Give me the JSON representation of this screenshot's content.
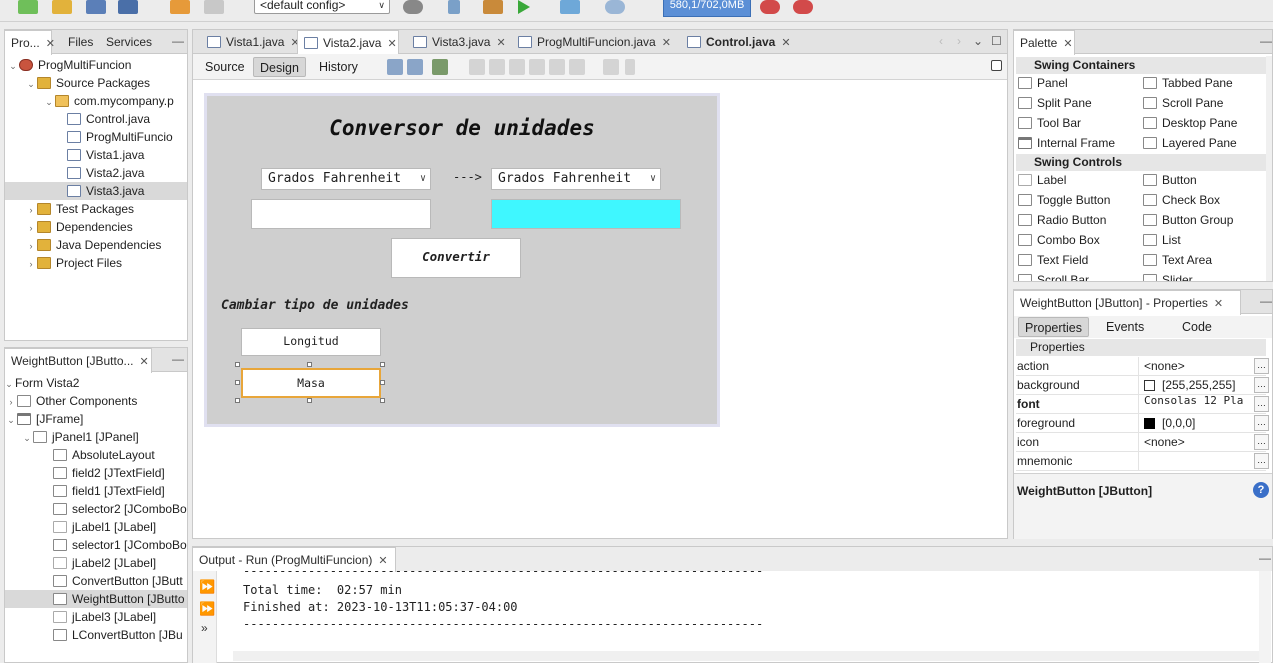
{
  "toolbar": {
    "config_value": "<default config>",
    "memory": "580,1/702,0MB"
  },
  "projects_panel": {
    "tabs": [
      "Pro...",
      "Files",
      "Services"
    ],
    "tree": [
      {
        "label": "ProgMultiFuncion",
        "icon": "project-icon"
      },
      {
        "label": "Source Packages",
        "icon": "folder-icon"
      },
      {
        "label": "com.mycompany.p",
        "icon": "package-icon"
      },
      {
        "label": "Control.java",
        "icon": "java-file-icon"
      },
      {
        "label": "ProgMultiFuncio",
        "icon": "java-file-icon"
      },
      {
        "label": "Vista1.java",
        "icon": "java-file-icon"
      },
      {
        "label": "Vista2.java",
        "icon": "java-file-icon"
      },
      {
        "label": "Vista3.java",
        "icon": "java-file-icon"
      },
      {
        "label": "Test Packages",
        "icon": "folder-icon"
      },
      {
        "label": "Dependencies",
        "icon": "folder-icon"
      },
      {
        "label": "Java Dependencies",
        "icon": "folder-icon"
      },
      {
        "label": "Project Files",
        "icon": "folder-icon"
      }
    ]
  },
  "navigator_panel": {
    "title": "WeightButton [JButto...",
    "tree": [
      {
        "label": "Form Vista2"
      },
      {
        "label": "Other Components"
      },
      {
        "label": "[JFrame]"
      },
      {
        "label": "jPanel1 [JPanel]"
      },
      {
        "label": "AbsoluteLayout"
      },
      {
        "label": "field2 [JTextField]"
      },
      {
        "label": "field1 [JTextField]"
      },
      {
        "label": "selector2 [JComboBo"
      },
      {
        "label": "jLabel1 [JLabel]"
      },
      {
        "label": "selector1 [JComboBo"
      },
      {
        "label": "jLabel2 [JLabel]"
      },
      {
        "label": "ConvertButton [JButt"
      },
      {
        "label": "WeightButton [JButto"
      },
      {
        "label": "jLabel3 [JLabel]"
      },
      {
        "label": "LConvertButton [JBu"
      }
    ]
  },
  "editor": {
    "tabs": [
      "Vista1.java",
      "Vista2.java",
      "Vista3.java",
      "ProgMultiFuncion.java",
      "Control.java"
    ],
    "modes": [
      "Source",
      "Design",
      "History"
    ]
  },
  "form": {
    "title": "Conversor de unidades",
    "selector1": "Grados Fahrenheit",
    "arrow": "--->",
    "selector2": "Grados Fahrenheit",
    "field1": "",
    "field2": "",
    "field2_color": "#3ff7ff",
    "convert_label": "Convertir",
    "change_label": "Cambiar tipo de unidades",
    "length_button": "Longitud",
    "weight_button": "Masa"
  },
  "palette": {
    "title": "Palette",
    "sections": [
      {
        "title": "Swing Containers",
        "items": [
          "Panel",
          "Tabbed Pane",
          "Split Pane",
          "Scroll Pane",
          "Tool Bar",
          "Desktop Pane",
          "Internal Frame",
          "Layered Pane"
        ]
      },
      {
        "title": "Swing Controls",
        "items": [
          "Label",
          "Button",
          "Toggle Button",
          "Check Box",
          "Radio Button",
          "Button Group",
          "Combo Box",
          "List",
          "Text Field",
          "Text Area",
          "Scroll Bar",
          "Slider"
        ]
      }
    ]
  },
  "properties": {
    "title": "WeightButton [JButton] - Properties",
    "tabs": [
      "Properties",
      "Events",
      "Code"
    ],
    "section": "Properties",
    "rows": [
      {
        "key": "action",
        "value": "<none>"
      },
      {
        "key": "background",
        "value": "[255,255,255]"
      },
      {
        "key": "font",
        "value": "Consolas 12 Pla"
      },
      {
        "key": "foreground",
        "value": "[0,0,0]"
      },
      {
        "key": "icon",
        "value": "<none>"
      },
      {
        "key": "mnemonic",
        "value": ""
      }
    ],
    "footer": "WeightButton [JButton]"
  },
  "output": {
    "title": "Output - Run (ProgMultiFuncion)",
    "lines": [
      "------------------------------------------------------------------------",
      "Total time:  02:57 min",
      "Finished at: 2023-10-13T11:05:37-04:00",
      "------------------------------------------------------------------------"
    ]
  }
}
